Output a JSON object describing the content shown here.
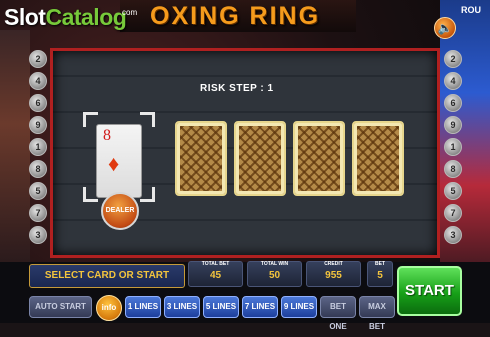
{
  "logo": {
    "slot": "Slot",
    "catalog": "Catalog",
    "com": "com"
  },
  "title": "OXING RING",
  "top_right_text": "ROU",
  "line_numbers_left": [
    "2",
    "4",
    "6",
    "9",
    "1",
    "8",
    "5",
    "7",
    "3"
  ],
  "line_numbers_right": [
    "2",
    "4",
    "6",
    "9",
    "1",
    "8",
    "5",
    "7",
    "3"
  ],
  "risk_step": "RISK STEP : 1",
  "dealer_card": {
    "rank": "8",
    "suit": "♦",
    "badge": "DEALER"
  },
  "face_down_cards": 4,
  "message": "SELECT CARD OR START",
  "stats": {
    "total_bet": {
      "label": "TOTAL BET",
      "value": "45"
    },
    "total_win": {
      "label": "TOTAL WIN",
      "value": "50"
    },
    "credit": {
      "label": "CREDIT",
      "value": "955"
    },
    "bet": {
      "label": "BET",
      "value": "5"
    }
  },
  "buttons": {
    "auto_start": "AUTO START",
    "info": "info",
    "lines_1": "1 LINES",
    "lines_3": "3 LINES",
    "lines_5": "5 LINES",
    "lines_7": "7 LINES",
    "lines_9": "9 LINES",
    "bet_one": "BET ONE",
    "max_bet": "MAX BET",
    "start": "START"
  },
  "colors": {
    "accent_orange": "#f59b1c",
    "start_green": "#17a018",
    "board_border": "#b02020",
    "value_yellow": "#f3c43d"
  }
}
